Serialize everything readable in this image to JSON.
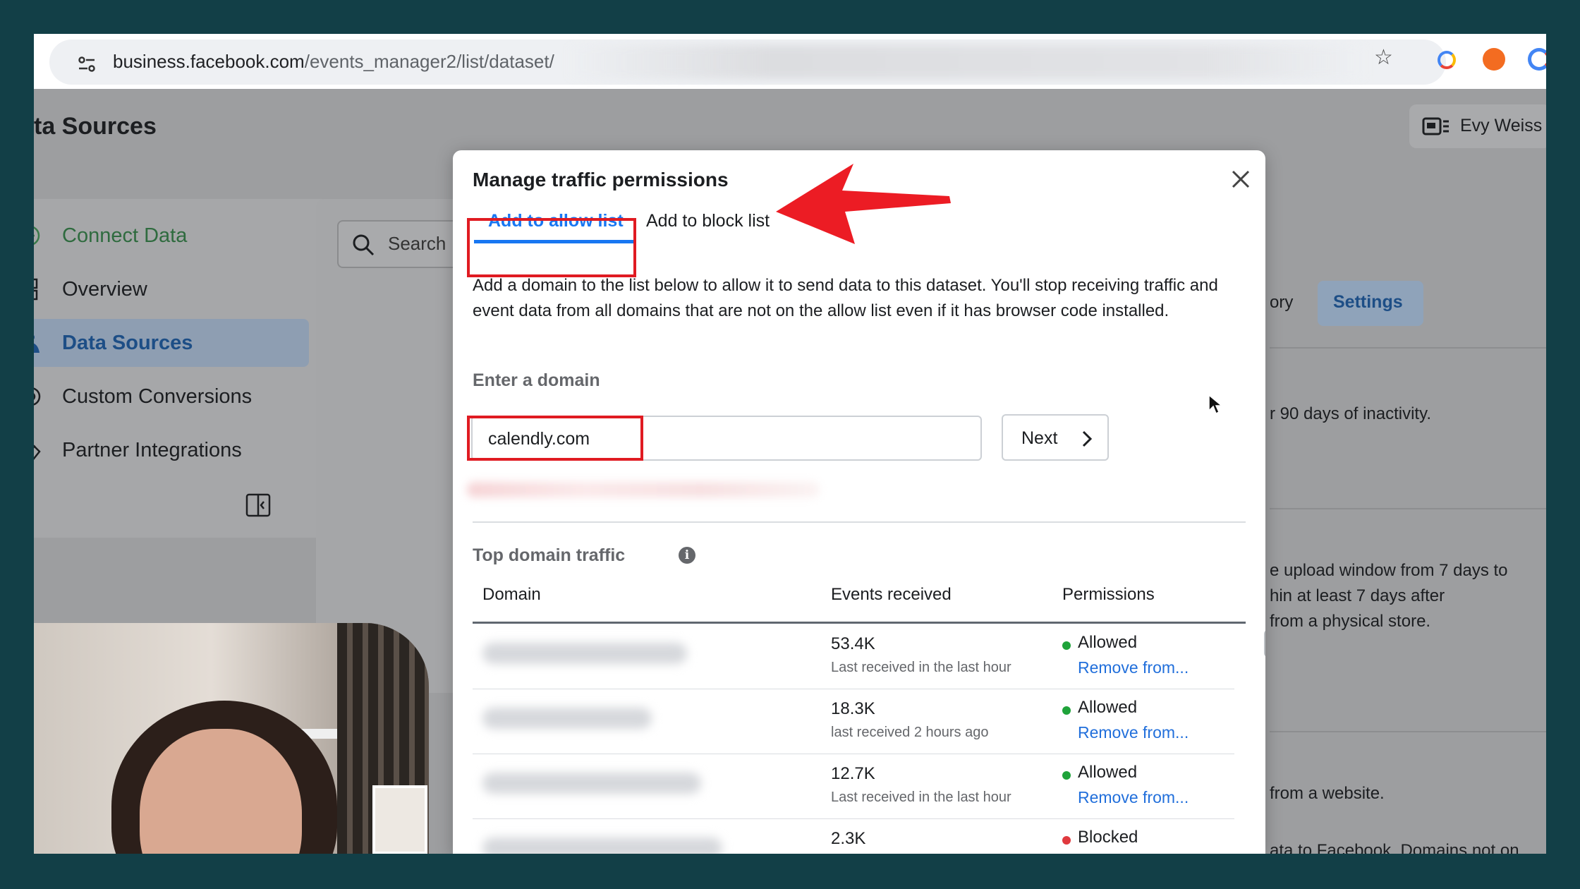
{
  "browser": {
    "url_domain": "business.facebook.com",
    "url_path": "/events_manager2/list/dataset/"
  },
  "app": {
    "page_title": "ta Sources",
    "user_name": "Evy Weiss",
    "search_placeholder": "Search",
    "settings_tab": "Settings",
    "history_tab_fragment": "ory",
    "sidebar": [
      {
        "label": "Connect Data",
        "icon": "plus-circle-icon"
      },
      {
        "label": "Overview",
        "icon": "overview-icon"
      },
      {
        "label": "Data Sources",
        "icon": "data-sources-icon"
      },
      {
        "label": "Custom Conversions",
        "icon": "custom-conversions-icon"
      },
      {
        "label": "Partner Integrations",
        "icon": "partner-integrations-icon"
      }
    ],
    "background_text": {
      "inactivity": "r 90 days of inactivity.",
      "upload_1": "e upload window from 7 days to",
      "upload_2": "hin at least 7 days after",
      "upload_3": "from a physical store.",
      "website": "from a website.",
      "bottom": "ata to Facebook. Domains not on"
    }
  },
  "modal": {
    "title": "Manage traffic permissions",
    "tabs": [
      {
        "label": "Add to allow list",
        "active": true
      },
      {
        "label": "Add to block list",
        "active": false
      }
    ],
    "description": "Add a domain to the list below to allow it to send data to this dataset. You'll stop receiving traffic and event data from all domains that are not on the allow list even if it has browser code installed.",
    "domain_label": "Enter a domain",
    "domain_value": "calendly.com",
    "next_label": "Next",
    "traffic_title": "Top domain traffic",
    "columns": [
      "Domain",
      "Events received",
      "Permissions"
    ],
    "rows": [
      {
        "events": "53.4K",
        "last": "Last received in the last hour",
        "permission": "Allowed",
        "action": "Remove from...",
        "status_color": "#1fa33a"
      },
      {
        "events": "18.3K",
        "last": "last received 2 hours ago",
        "permission": "Allowed",
        "action": "Remove from...",
        "status_color": "#1fa33a"
      },
      {
        "events": "12.7K",
        "last": "Last received in the last hour",
        "permission": "Allowed",
        "action": "Remove from...",
        "status_color": "#1fa33a"
      },
      {
        "events": "2.3K",
        "last": "",
        "permission": "Blocked",
        "action": "",
        "status_color": "#e0393e"
      }
    ]
  },
  "colors": {
    "accent": "#1877f2",
    "highlight": "#e01b22",
    "background": "#123f47"
  }
}
